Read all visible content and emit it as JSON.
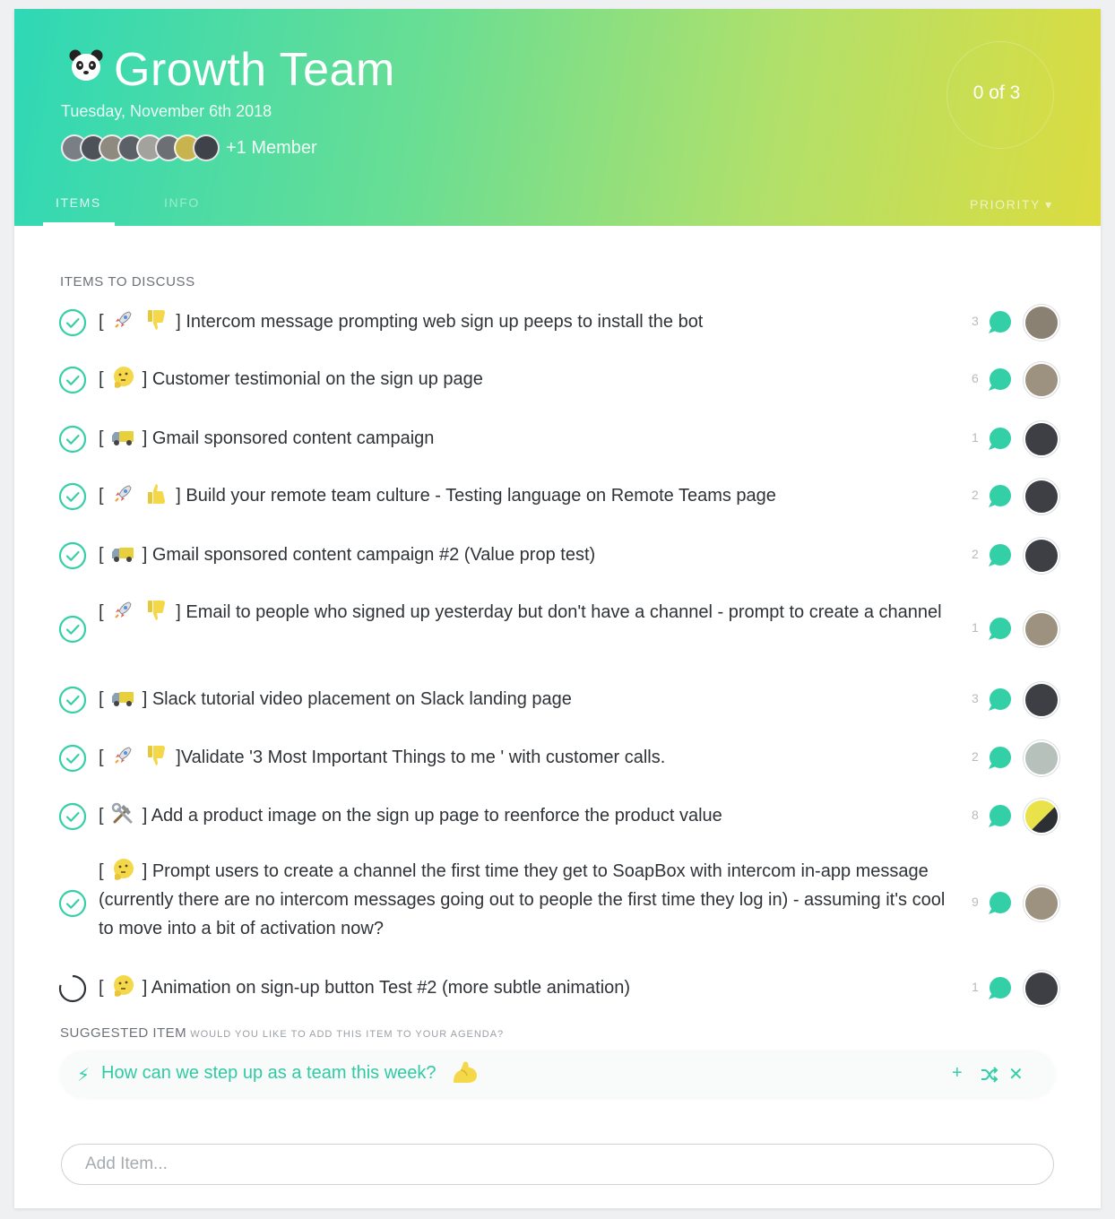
{
  "header": {
    "team_icon": "panda-icon",
    "title": "Growth Team",
    "date": "Tuesday, November 6th 2018",
    "extra_members": "+1 Member",
    "progress": "0 of 3",
    "tabs": [
      {
        "label": "ITEMS",
        "active": true
      },
      {
        "label": "INFO",
        "active": false
      }
    ],
    "sort_label": "PRIORITY ▾"
  },
  "section_label": "ITEMS TO DISCUSS",
  "items": [
    {
      "emoji": [
        "rocket-emoji",
        "thumbs-down-emoji"
      ],
      "text": "Intercom message prompting web sign up peeps to install the bot",
      "comments": "3",
      "done": true
    },
    {
      "emoji": [
        "thinking-emoji"
      ],
      "text": "Customer testimonial on the sign up page",
      "comments": "6",
      "done": true
    },
    {
      "emoji": [
        "truck-emoji"
      ],
      "text": "Gmail sponsored content campaign",
      "comments": "1",
      "done": true
    },
    {
      "emoji": [
        "rocket-emoji",
        "thumbs-up-emoji"
      ],
      "text": "Build your remote team culture - Testing language on Remote Teams page",
      "comments": "2",
      "done": true
    },
    {
      "emoji": [
        "truck-emoji"
      ],
      "text": "Gmail sponsored content campaign #2 (Value prop test)",
      "comments": "2",
      "done": true
    },
    {
      "emoji": [
        "rocket-emoji",
        "thumbs-down-emoji"
      ],
      "text": "Email to people who signed up yesterday but don't have a channel - prompt to create a channel",
      "comments": "1",
      "done": true
    },
    {
      "emoji": [
        "truck-emoji"
      ],
      "text": "Slack tutorial video placement on Slack landing page",
      "comments": "3",
      "done": true
    },
    {
      "emoji": [
        "rocket-emoji",
        "thumbs-down-emoji"
      ],
      "text": "Validate '3 Most Important Things to me ' with customer calls.",
      "comments": "2",
      "done": true
    },
    {
      "emoji": [
        "hammer-wrench-emoji"
      ],
      "text": "Add a product image on the sign up page to reenforce the product value",
      "comments": "8",
      "done": true
    },
    {
      "emoji": [
        "thinking-emoji"
      ],
      "text": "Prompt users to create a channel the first time they get to SoapBox with intercom in-app message (currently there are no intercom messages going out to people the first time they log in) - assuming it's cool to move into a bit of activation now?",
      "comments": "9",
      "done": true
    },
    {
      "emoji": [
        "thinking-emoji"
      ],
      "text": "Animation on sign-up button Test #2 (more subtle animation)",
      "comments": "1",
      "done": false
    }
  ],
  "suggested": {
    "label": "SUGGESTED ITEM",
    "sublabel": "WOULD YOU LIKE TO ADD THIS ITEM TO YOUR AGENDA?",
    "icon": "lightning-icon",
    "text": "How can we step up as a team this week?",
    "emoji": "flexed-biceps-emoji",
    "actions": [
      "plus-icon",
      "shuffle-icon",
      "close-icon"
    ]
  },
  "add_item": {
    "placeholder": "Add Item..."
  },
  "colors": {
    "accent": "#33cfa7",
    "gradient_start": "#2ed8b6",
    "gradient_end": "#dcdc3f",
    "text": "#2f3337"
  }
}
